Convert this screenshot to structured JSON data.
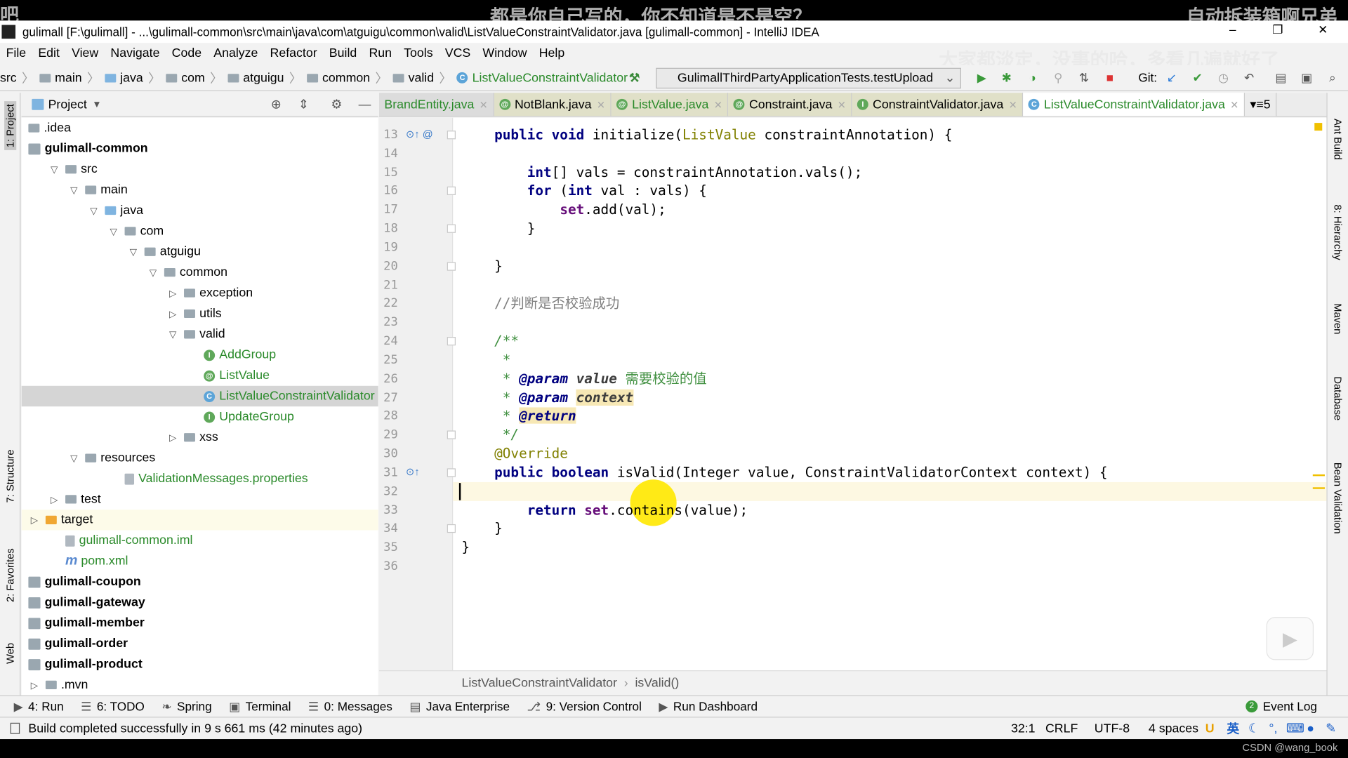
{
  "overlays": {
    "top_left": "吧",
    "top_center": "都是你自己写的，你不知道是不是空？",
    "top_right": "自动拆装箱啊兄弟",
    "menu_right": "大家都淡定，没事的哈，多看几遍就好了",
    "watermark": "CSDN @wang_book"
  },
  "window": {
    "title": "gulimall [F:\\gulimall] - ...\\gulimall-common\\src\\main\\java\\com\\atguigu\\common\\valid\\ListValueConstraintValidator.java [gulimall-common] - IntelliJ IDEA",
    "controls": [
      "–",
      "❐",
      "✕"
    ]
  },
  "menu": [
    "File",
    "Edit",
    "View",
    "Navigate",
    "Code",
    "Analyze",
    "Refactor",
    "Build",
    "Run",
    "Tools",
    "VCS",
    "Window",
    "Help"
  ],
  "breadcrumbs": [
    "src",
    "main",
    "java",
    "com",
    "atguigu",
    "common",
    "valid",
    "ListValueConstraintValidator"
  ],
  "run_config": "GulimallThirdPartyApplicationTests.testUpload",
  "git_label": "Git:",
  "left_strip": [
    "1: Project",
    "7: Structure",
    "2: Favorites",
    "Web"
  ],
  "right_strip": [
    "Ant Build",
    "8: Hierarchy",
    "Maven",
    "Database",
    "Bean Validation"
  ],
  "project_panel": {
    "title": "Project",
    "tree": [
      {
        "label": ".idea",
        "level": 0,
        "arrow": "",
        "icon": "folder",
        "bold": false
      },
      {
        "label": "gulimall-common",
        "level": 0,
        "arrow": "",
        "icon": "module",
        "bold": true
      },
      {
        "label": "src",
        "level": 1,
        "arrow": "down",
        "icon": "folder"
      },
      {
        "label": "main",
        "level": 2,
        "arrow": "down",
        "icon": "folder"
      },
      {
        "label": "java",
        "level": 3,
        "arrow": "down",
        "icon": "folder-blue"
      },
      {
        "label": "com",
        "level": 4,
        "arrow": "down",
        "icon": "package"
      },
      {
        "label": "atguigu",
        "level": 5,
        "arrow": "down",
        "icon": "package"
      },
      {
        "label": "common",
        "level": 6,
        "arrow": "down",
        "icon": "package"
      },
      {
        "label": "exception",
        "level": 7,
        "arrow": "right",
        "icon": "package"
      },
      {
        "label": "utils",
        "level": 7,
        "arrow": "right",
        "icon": "package"
      },
      {
        "label": "valid",
        "level": 7,
        "arrow": "down",
        "icon": "package"
      },
      {
        "label": "AddGroup",
        "level": 8,
        "arrow": "",
        "icon": "interface",
        "color": "#2a8a2a"
      },
      {
        "label": "ListValue",
        "level": 8,
        "arrow": "",
        "icon": "annotation",
        "color": "#2a8a2a"
      },
      {
        "label": "ListValueConstraintValidator",
        "level": 8,
        "arrow": "",
        "icon": "class",
        "color": "#2a8a2a",
        "selected": true
      },
      {
        "label": "UpdateGroup",
        "level": 8,
        "arrow": "",
        "icon": "interface",
        "color": "#2a8a2a"
      },
      {
        "label": "xss",
        "level": 7,
        "arrow": "right",
        "icon": "package"
      },
      {
        "label": "resources",
        "level": 2,
        "arrow": "down",
        "icon": "folder"
      },
      {
        "label": "ValidationMessages.properties",
        "level": 4,
        "arrow": "",
        "icon": "properties",
        "color": "#2a8a2a"
      },
      {
        "label": "test",
        "level": 1,
        "arrow": "right",
        "icon": "folder"
      },
      {
        "label": "target",
        "level": 0,
        "arrow": "right",
        "icon": "folder-orange",
        "highlight": true
      },
      {
        "label": "gulimall-common.iml",
        "level": 1,
        "arrow": "",
        "icon": "file",
        "color": "#2a8a2a"
      },
      {
        "label": "pom.xml",
        "level": 1,
        "arrow": "",
        "icon": "maven",
        "color": "#2a8a2a"
      },
      {
        "label": "gulimall-coupon",
        "level": 0,
        "arrow": "",
        "icon": "module",
        "bold": true
      },
      {
        "label": "gulimall-gateway",
        "level": 0,
        "arrow": "",
        "icon": "module",
        "bold": true
      },
      {
        "label": "gulimall-member",
        "level": 0,
        "arrow": "",
        "icon": "module",
        "bold": true
      },
      {
        "label": "gulimall-order",
        "level": 0,
        "arrow": "",
        "icon": "module",
        "bold": true
      },
      {
        "label": "gulimall-product",
        "level": 0,
        "arrow": "",
        "icon": "module",
        "bold": true
      },
      {
        "label": ".mvn",
        "level": 0,
        "arrow": "right",
        "icon": "folder"
      }
    ]
  },
  "editor_tabs": [
    {
      "label": "BrandEntity.java",
      "icon": "class",
      "style": "gray"
    },
    {
      "label": "NotBlank.java",
      "icon": "annotation"
    },
    {
      "label": "ListValue.java",
      "icon": "annotation",
      "green": true
    },
    {
      "label": "Constraint.java",
      "icon": "annotation"
    },
    {
      "label": "ConstraintValidator.java",
      "icon": "interface"
    },
    {
      "label": "ListValueConstraintValidator.java",
      "icon": "class",
      "active": true
    }
  ],
  "tabs_overflow": "5",
  "code": {
    "first_line": 13,
    "lines": [
      [
        {
          "t": "    "
        },
        {
          "t": "public void ",
          "c": "kw"
        },
        {
          "t": "initialize("
        },
        {
          "t": "ListValue",
          "c": "ty"
        },
        {
          "t": " constraintAnnotation) {"
        }
      ],
      [],
      [
        {
          "t": "        "
        },
        {
          "t": "int",
          "c": "kw"
        },
        {
          "t": "[] vals = constraintAnnotation.vals();"
        }
      ],
      [
        {
          "t": "        "
        },
        {
          "t": "for ",
          "c": "kw"
        },
        {
          "t": "("
        },
        {
          "t": "int ",
          "c": "kw"
        },
        {
          "t": "val : vals) {"
        }
      ],
      [
        {
          "t": "            "
        },
        {
          "t": "set",
          "c": "fld"
        },
        {
          "t": ".add(val);"
        }
      ],
      [
        {
          "t": "        }"
        }
      ],
      [],
      [
        {
          "t": "    }"
        }
      ],
      [],
      [
        {
          "t": "    "
        },
        {
          "t": "//判断是否校验成功",
          "c": "cm"
        }
      ],
      [],
      [
        {
          "t": "    "
        },
        {
          "t": "/**",
          "c": "doc"
        }
      ],
      [
        {
          "t": "     "
        },
        {
          "t": "*",
          "c": "doc"
        }
      ],
      [
        {
          "t": "     "
        },
        {
          "t": "* ",
          "c": "doc"
        },
        {
          "t": "@param",
          "c": "tag"
        },
        {
          "t": " "
        },
        {
          "t": "value",
          "c": "pn"
        },
        {
          "t": " 需要校验的值",
          "c": "docz"
        }
      ],
      [
        {
          "t": "     "
        },
        {
          "t": "* ",
          "c": "doc"
        },
        {
          "t": "@param",
          "c": "tag"
        },
        {
          "t": " "
        },
        {
          "t": "context",
          "c": "pn hlb"
        }
      ],
      [
        {
          "t": "     "
        },
        {
          "t": "* ",
          "c": "doc"
        },
        {
          "t": "@return",
          "c": "tag hlb"
        }
      ],
      [
        {
          "t": "     "
        },
        {
          "t": "*/",
          "c": "doc"
        }
      ],
      [
        {
          "t": "    "
        },
        {
          "t": "@Override",
          "c": "ann"
        }
      ],
      [
        {
          "t": "    "
        },
        {
          "t": "public boolean ",
          "c": "kw"
        },
        {
          "t": "isValid(Integer value, ConstraintValidatorContext context) {"
        }
      ],
      [],
      [
        {
          "t": "        "
        },
        {
          "t": "return ",
          "c": "kw"
        },
        {
          "t": "set",
          "c": "fld"
        },
        {
          "t": ".contains(value);"
        }
      ],
      [
        {
          "t": "    }"
        }
      ],
      [
        {
          "t": "}"
        }
      ],
      []
    ]
  },
  "editor_breadcrumb": [
    "ListValueConstraintValidator",
    "isValid()"
  ],
  "tool_windows": [
    {
      "icon": "▶",
      "label": "4: Run"
    },
    {
      "icon": "☰",
      "label": "6: TODO"
    },
    {
      "icon": "❧",
      "label": "Spring"
    },
    {
      "icon": "▣",
      "label": "Terminal"
    },
    {
      "icon": "☰",
      "label": "0: Messages"
    },
    {
      "icon": "▤",
      "label": "Java Enterprise"
    },
    {
      "icon": "⎇",
      "label": "9: Version Control"
    },
    {
      "icon": "▶",
      "label": "Run Dashboard"
    }
  ],
  "event_log": {
    "label": "Event Log",
    "count": "2"
  },
  "status": {
    "message": "Build completed successfully in 9 s 661 ms (42 minutes ago)",
    "position": "32:1",
    "line_sep": "CRLF",
    "encoding": "UTF-8",
    "indent": "4 spaces",
    "ime": "英"
  },
  "colors": {
    "accent_green": "#2a8a2a",
    "keyword": "#000080",
    "highlight": "#ffe800"
  }
}
